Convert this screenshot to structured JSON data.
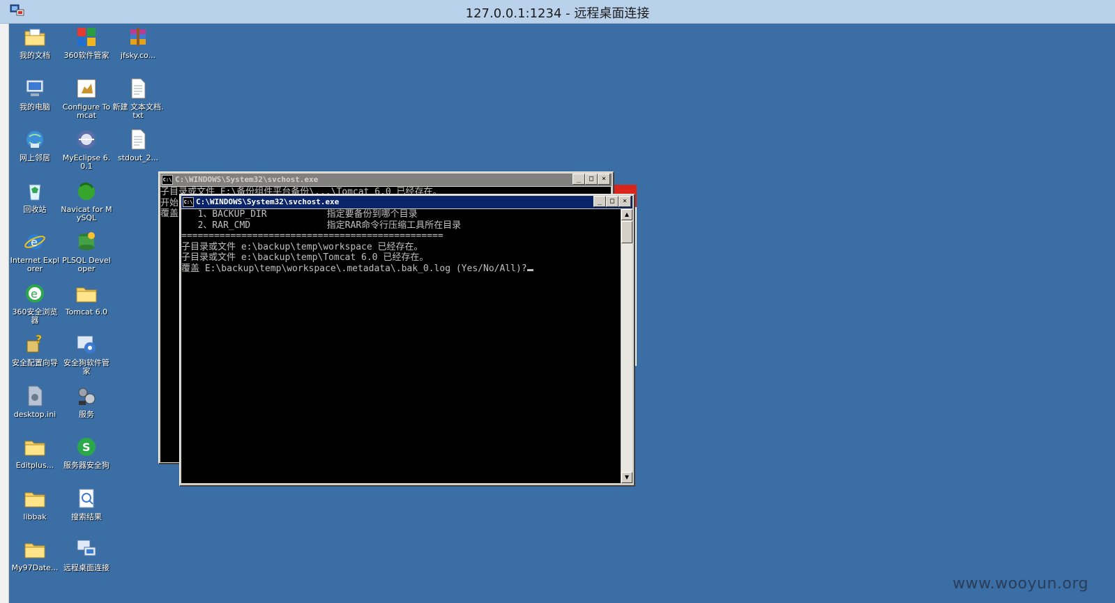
{
  "window": {
    "title": "127.0.0.1:1234 - 远程桌面连接"
  },
  "desktop": {
    "icons": [
      {
        "label": "我的文档",
        "icon": "my-documents-icon"
      },
      {
        "label": "360软件管家",
        "icon": "360-software-manager-icon"
      },
      {
        "label": "jfsky.co...",
        "icon": "winrar-archive-icon"
      },
      {
        "label": "我的电脑",
        "icon": "my-computer-icon"
      },
      {
        "label": "Configure Tomcat",
        "icon": "tomcat-config-icon"
      },
      {
        "label": "新建 文本文档.txt",
        "icon": "text-file-icon"
      },
      {
        "label": "网上邻居",
        "icon": "network-places-icon"
      },
      {
        "label": "MyEclipse 6.0.1",
        "icon": "myeclipse-icon"
      },
      {
        "label": "stdout_2...",
        "icon": "text-file-icon"
      },
      {
        "label": "回收站",
        "icon": "recycle-bin-icon"
      },
      {
        "label": "Navicat for MySQL",
        "icon": "navicat-icon"
      },
      {
        "label": "Internet Explorer",
        "icon": "internet-explorer-icon"
      },
      {
        "label": "PLSQL Developer",
        "icon": "plsql-developer-icon"
      },
      {
        "label": "360安全浏览器",
        "icon": "360-browser-icon"
      },
      {
        "label": "Tomcat 6.0",
        "icon": "folder-icon"
      },
      {
        "label": "安全配置向导",
        "icon": "security-wizard-icon"
      },
      {
        "label": "安全狗软件管家",
        "icon": "safedog-manager-icon"
      },
      {
        "label": "desktop.ini",
        "icon": "settings-file-icon"
      },
      {
        "label": "服务",
        "icon": "services-icon"
      },
      {
        "label": "Editplus...",
        "icon": "folder-icon"
      },
      {
        "label": "服务器安全狗",
        "icon": "server-safedog-icon"
      },
      {
        "label": "libbak",
        "icon": "folder-icon"
      },
      {
        "label": "搜索结果",
        "icon": "search-results-icon"
      },
      {
        "label": "My97Date...",
        "icon": "folder-icon"
      },
      {
        "label": "远程桌面连接",
        "icon": "remote-desktop-icon"
      }
    ]
  },
  "console_back": {
    "title": "C:\\WINDOWS\\System32\\svchost.exe",
    "lines": [
      "子目录或文件 E:\\备份组件平台备份\\...\\Tomcat 6.0 已经存在。",
      "开始...",
      "覆盖..."
    ]
  },
  "console_front": {
    "title": "C:\\WINDOWS\\System32\\svchost.exe",
    "lines": [
      "   1、BACKUP_DIR           指定要备份到哪个目录",
      "   2、RAR_CMD              指定RAR命令行压缩工具所在目录",
      "================================================",
      "子目录或文件 e:\\backup\\temp\\workspace 已经存在。",
      "子目录或文件 e:\\backup\\temp\\Tomcat 6.0 已经存在。",
      "覆盖 E:\\backup\\temp\\workspace\\.metadata\\.bak_0.log (Yes/No/All)?"
    ]
  },
  "watermark": "www.wooyun.org",
  "colors": {
    "desktop": "#3a6ea5",
    "titlebar": "#b9d1ea",
    "console_title_active": "#0a246a",
    "console_title_inactive": "#808080"
  }
}
